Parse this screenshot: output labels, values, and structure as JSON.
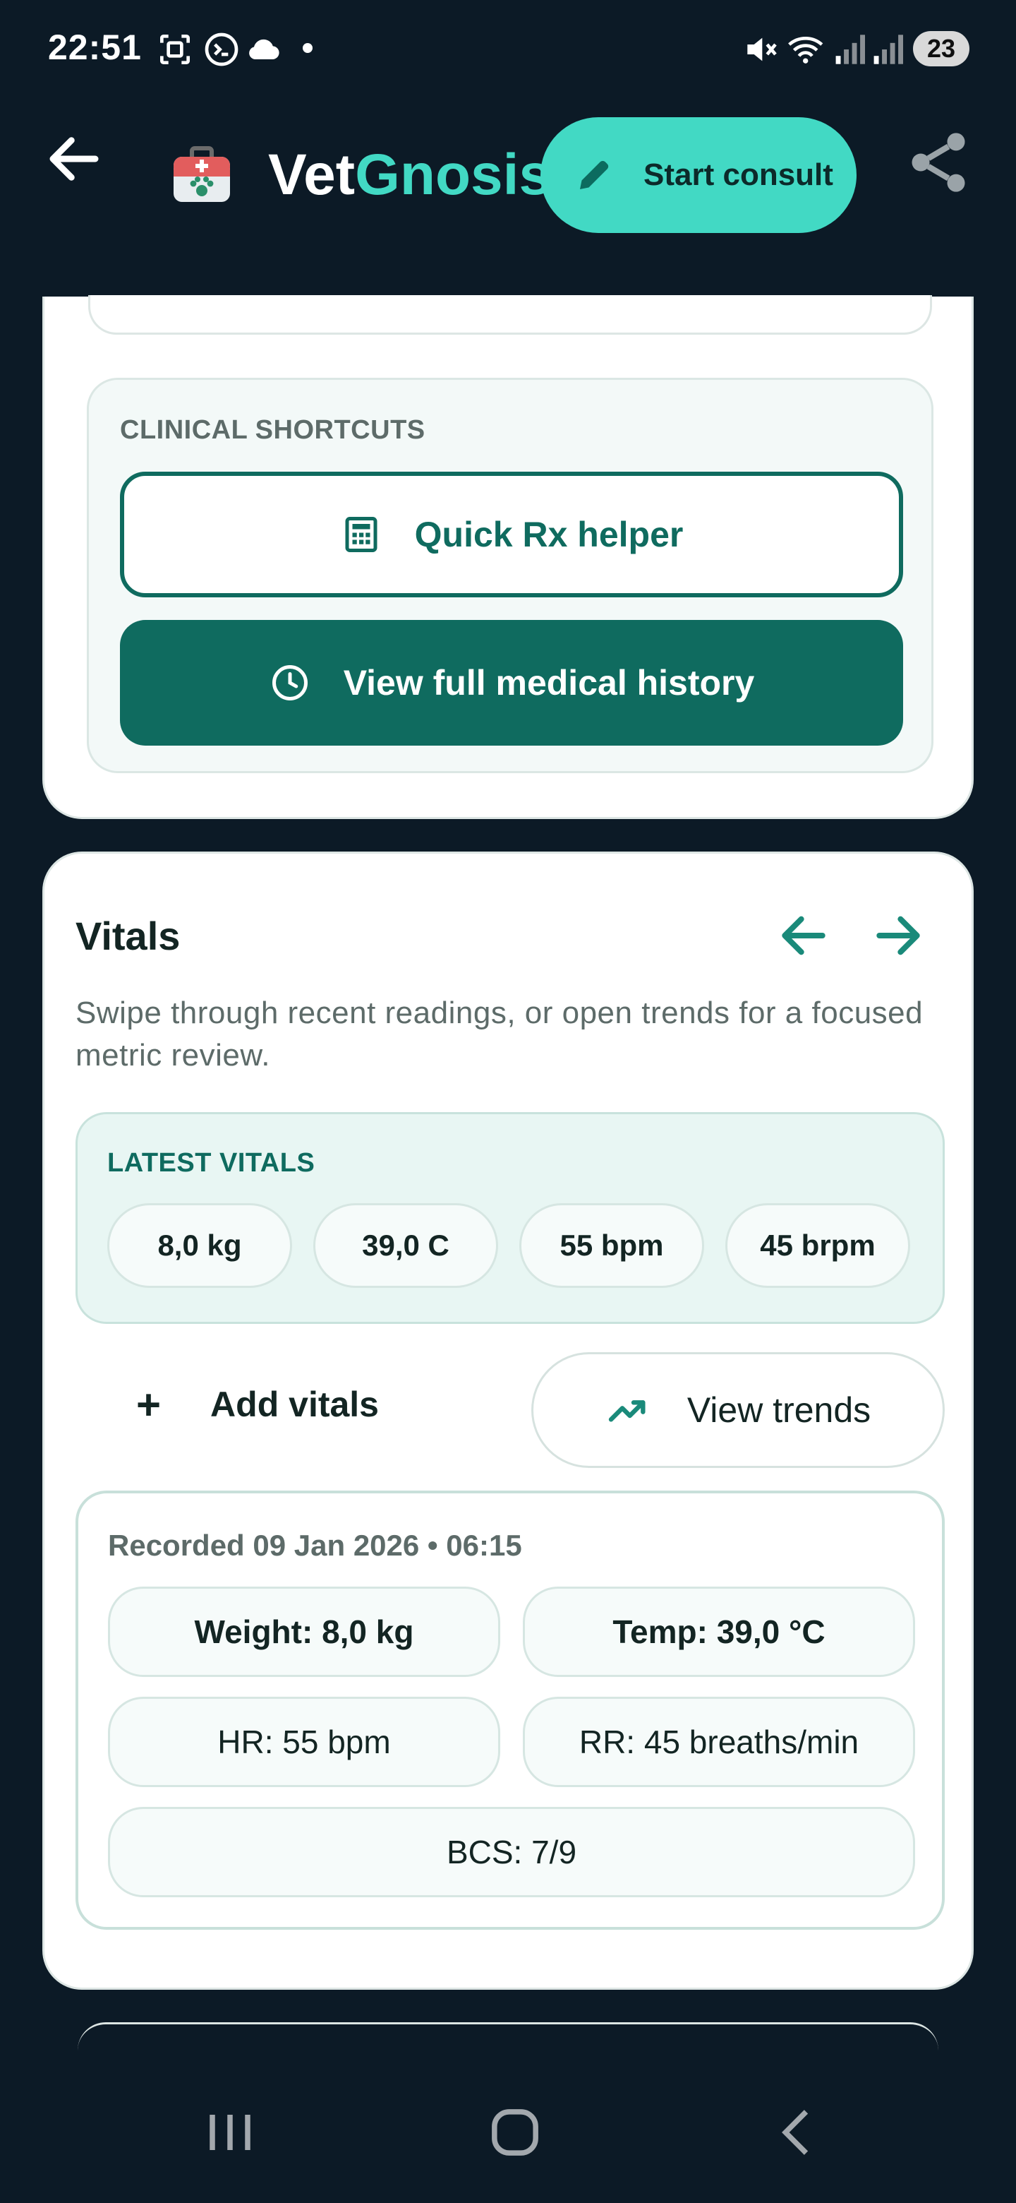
{
  "status_bar": {
    "time": "22:51",
    "battery": "23",
    "icons": [
      "screenshot-icon",
      "terminal-icon",
      "cloud-icon",
      "dot-icon",
      "mute-icon",
      "wifi-icon",
      "signal-icon",
      "signal-icon"
    ]
  },
  "app_bar": {
    "brand_prefix": "Vet",
    "brand_suffix": "Gnosis",
    "start_consult_label": "Start consult"
  },
  "shortcuts": {
    "caption": "CLINICAL SHORTCUTS",
    "quick_rx_label": "Quick Rx helper",
    "history_label": "View full medical history"
  },
  "vitals": {
    "title": "Vitals",
    "description": "Swipe through recent readings, or open trends for a focused metric review.",
    "latest_caption": "LATEST VITALS",
    "latest": [
      "8,0 kg",
      "39,0 C",
      "55 bpm",
      "45 brpm"
    ],
    "add_label": "Add vitals",
    "trends_label": "View trends",
    "recorded": {
      "caption": "Recorded 09 Jan 2026 • 06:15",
      "weight": "Weight: 8,0 kg",
      "temp": "Temp: 39,0 °C",
      "hr": "HR: 55 bpm",
      "rr": "RR: 45 breaths/min",
      "bcs": "BCS: 7/9"
    }
  },
  "colors": {
    "accent": "#42d9c4",
    "primary": "#0f6b5f",
    "background": "#0c1a26"
  }
}
